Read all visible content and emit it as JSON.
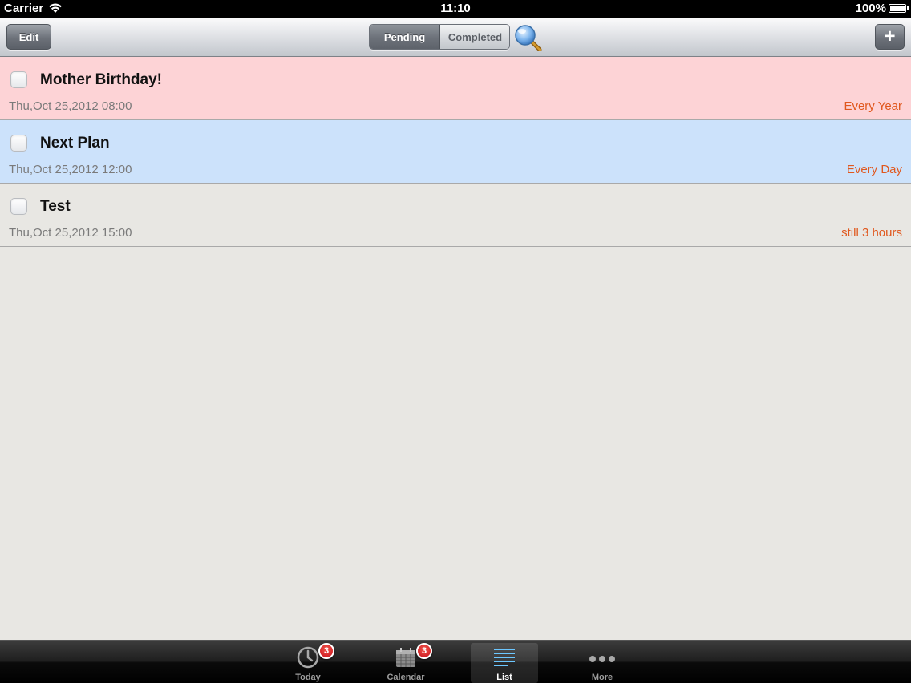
{
  "status_bar": {
    "carrier": "Carrier",
    "time": "11:10",
    "battery": "100%"
  },
  "toolbar": {
    "edit_label": "Edit",
    "segments": [
      "Pending",
      "Completed"
    ],
    "selected_segment": "Pending",
    "add_label": "+"
  },
  "items": [
    {
      "title": "Mother Birthday!",
      "datetime": "Thu,Oct 25,2012 08:00",
      "repeat": "Every Year",
      "row_color": "#fdd3d6",
      "checked": false
    },
    {
      "title": "Next Plan",
      "datetime": "Thu,Oct 25,2012 12:00",
      "repeat": "Every Day",
      "row_color": "#cce2fb",
      "checked": false
    },
    {
      "title": "Test",
      "datetime": "Thu,Oct 25,2012 15:00",
      "repeat": "still 3 hours",
      "row_color": "#e8e7e3",
      "checked": false
    }
  ],
  "tabs": [
    {
      "label": "Today",
      "icon": "clock-icon",
      "badge": "3",
      "selected": false
    },
    {
      "label": "Calendar",
      "icon": "calendar-icon",
      "badge": "3",
      "selected": false
    },
    {
      "label": "List",
      "icon": "list-icon",
      "badge": null,
      "selected": true
    },
    {
      "label": "More",
      "icon": "more-dots-icon",
      "badge": null,
      "selected": false
    }
  ],
  "colors": {
    "accent_orange": "#e0581e",
    "badge_red": "#d6202a",
    "background": "#e8e7e3"
  }
}
